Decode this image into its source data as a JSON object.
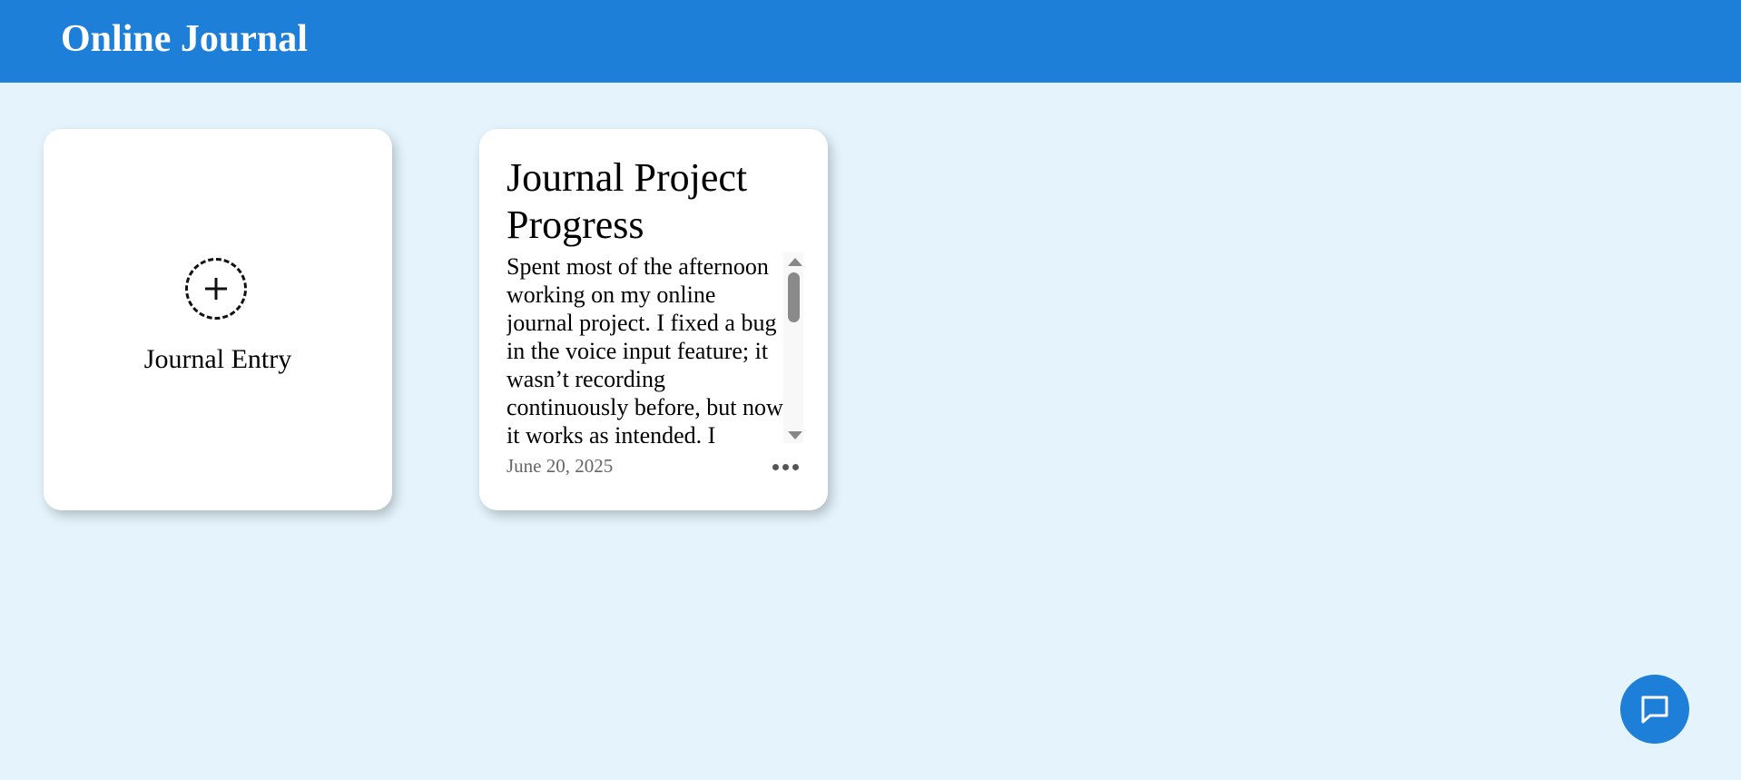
{
  "header": {
    "title": "Online Journal"
  },
  "new_entry_card": {
    "icon": "plus-circle-icon",
    "label": "Journal Entry"
  },
  "entries": [
    {
      "title": "Journal Project Progress",
      "body": "Spent most of the afternoon working on my online journal project. I fixed a bug in the voice input feature; it wasn’t recording continuously before, but now it works as intended. I",
      "date": "June 20, 2025",
      "more_icon": "more-horizontal-icon"
    }
  ],
  "chat_button": {
    "icon": "chat-bubble-icon"
  },
  "colors": {
    "header_bg": "#1e7fd8",
    "page_bg": "#e4f3fc",
    "card_bg": "#ffffff",
    "fab_bg": "#1e7fd8"
  }
}
